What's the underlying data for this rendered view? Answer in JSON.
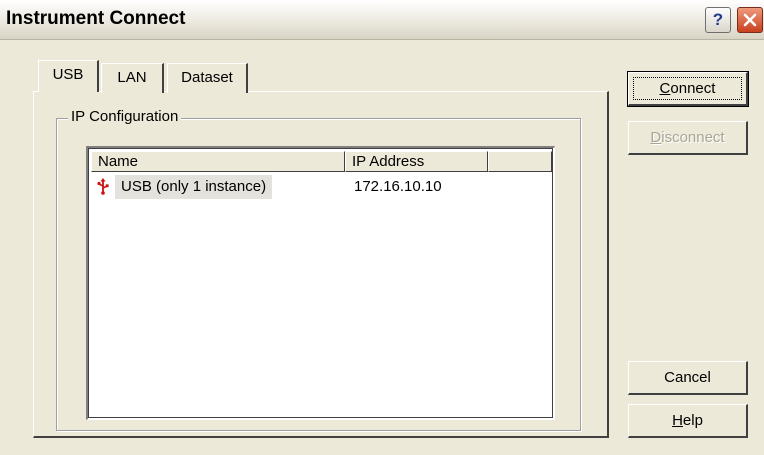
{
  "window": {
    "title": "Instrument Connect",
    "help_glyph": "?",
    "close_glyph": "✕"
  },
  "tabs": [
    {
      "label": "USB",
      "selected": true
    },
    {
      "label": "LAN",
      "selected": false
    },
    {
      "label": "Dataset",
      "selected": false
    }
  ],
  "group": {
    "label": "IP Configuration"
  },
  "list": {
    "columns": [
      "Name",
      "IP Address",
      ""
    ],
    "rows": [
      {
        "icon": "usb-icon",
        "name": "USB (only 1 instance)",
        "ip": "172.16.10.10"
      }
    ]
  },
  "buttons": {
    "connect": {
      "mnemonic": "C",
      "rest": "onnect",
      "enabled": true
    },
    "disconnect": {
      "mnemonic": "D",
      "rest": "isconnect",
      "enabled": false
    },
    "cancel": {
      "label": "Cancel"
    },
    "help": {
      "mnemonic": "H",
      "rest": "elp"
    }
  },
  "colors": {
    "dialog_bg": "#ece9d8",
    "usb_icon": "#cc1111",
    "disabled_text": "#a7a596"
  }
}
